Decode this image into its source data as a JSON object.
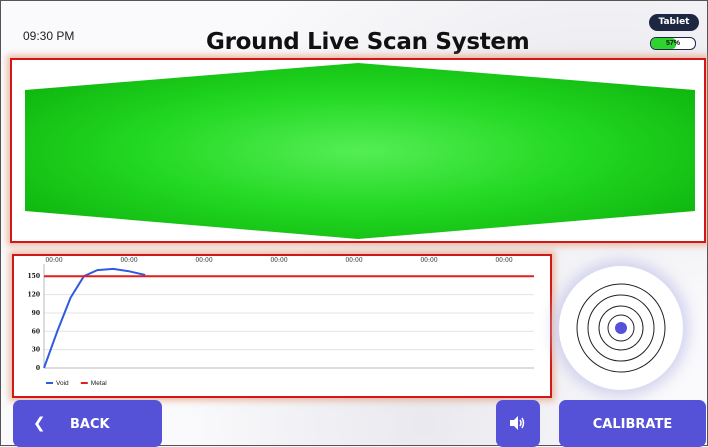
{
  "header": {
    "time": "09:30 PM",
    "title": "Ground Live Scan System",
    "device_label": "Tablet",
    "battery_text": "57%",
    "battery_level": 0.57
  },
  "scan_view": {
    "fill_color": "#1fd41f",
    "border_color": "#d01818"
  },
  "chart_data": {
    "type": "line",
    "x_tick_labels": [
      "00:00",
      "00:00",
      "00:00",
      "00:00",
      "00:00",
      "00:00",
      "00:00"
    ],
    "y_ticks": [
      0,
      30,
      60,
      90,
      120,
      150
    ],
    "ylim": [
      0,
      170
    ],
    "series": [
      {
        "name": "Void",
        "color": "#2f5be0",
        "points": [
          [
            0,
            0
          ],
          [
            0.25,
            60
          ],
          [
            0.5,
            115
          ],
          [
            0.75,
            150
          ],
          [
            1.0,
            160
          ],
          [
            1.3,
            162
          ],
          [
            1.6,
            158
          ],
          [
            1.9,
            152
          ]
        ]
      },
      {
        "name": "Metal",
        "color": "#e02020",
        "points": [
          [
            0,
            150
          ],
          [
            9.2,
            150
          ]
        ]
      }
    ],
    "legend_position": "bottom-left"
  },
  "buttons": {
    "back_label": "BACK",
    "calibrate_label": "CALIBRATE"
  },
  "icons": {
    "back": "chevron-left-icon",
    "sound": "speaker-icon",
    "radar": "target-radar-icon"
  }
}
